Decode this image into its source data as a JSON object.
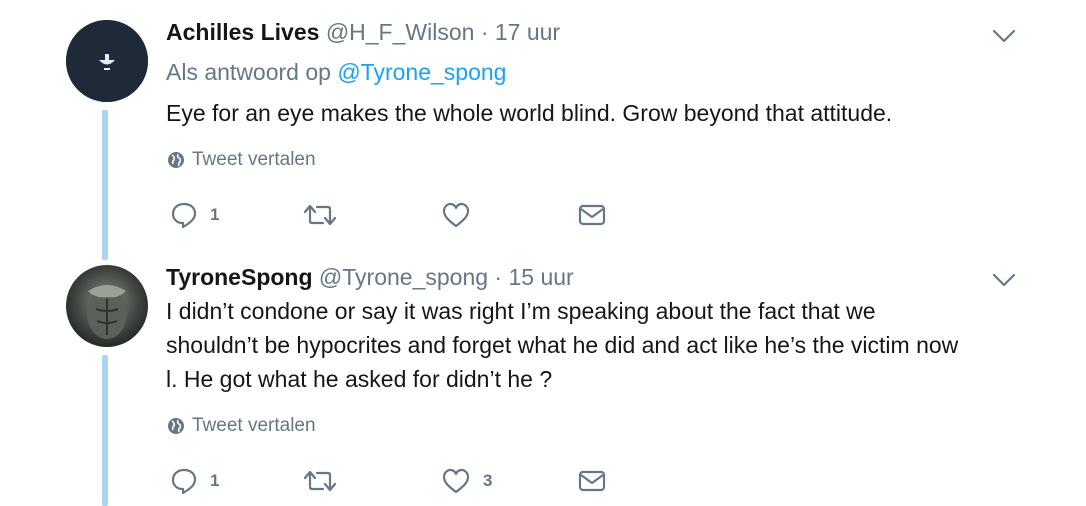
{
  "tweets": [
    {
      "name": "Achilles Lives",
      "handle": "@H_F_Wilson",
      "separator": "·",
      "time": "17 uur",
      "reply_prefix": "Als antwoord op ",
      "reply_mention": "@Tyrone_spong",
      "text": "Eye for an eye makes the whole world blind. Grow beyond that attitude.",
      "translate_label": "Tweet vertalen",
      "reply_count": "1",
      "retweet_count": "",
      "like_count": ""
    },
    {
      "name": "TyroneSpong",
      "handle": "@Tyrone_spong",
      "separator": "·",
      "time": "15 uur",
      "text_lines": [
        "I didn’t condone or say it was right I’m speaking about the fact that we",
        "shouldn’t be hypocrites and forget what he did and act like he’s the victim now",
        "l. He got what he asked for didn’t he ?"
      ],
      "translate_label": "Tweet vertalen",
      "reply_count": "1",
      "retweet_count": "",
      "like_count": "3"
    }
  ],
  "colors": {
    "text": "#14171a",
    "secondary": "#657786",
    "link": "#1da1f2",
    "thread_line": "#abd3f2"
  },
  "icons": [
    "chevron-down-icon",
    "globe-icon",
    "reply-icon",
    "retweet-icon",
    "like-icon",
    "message-icon"
  ]
}
